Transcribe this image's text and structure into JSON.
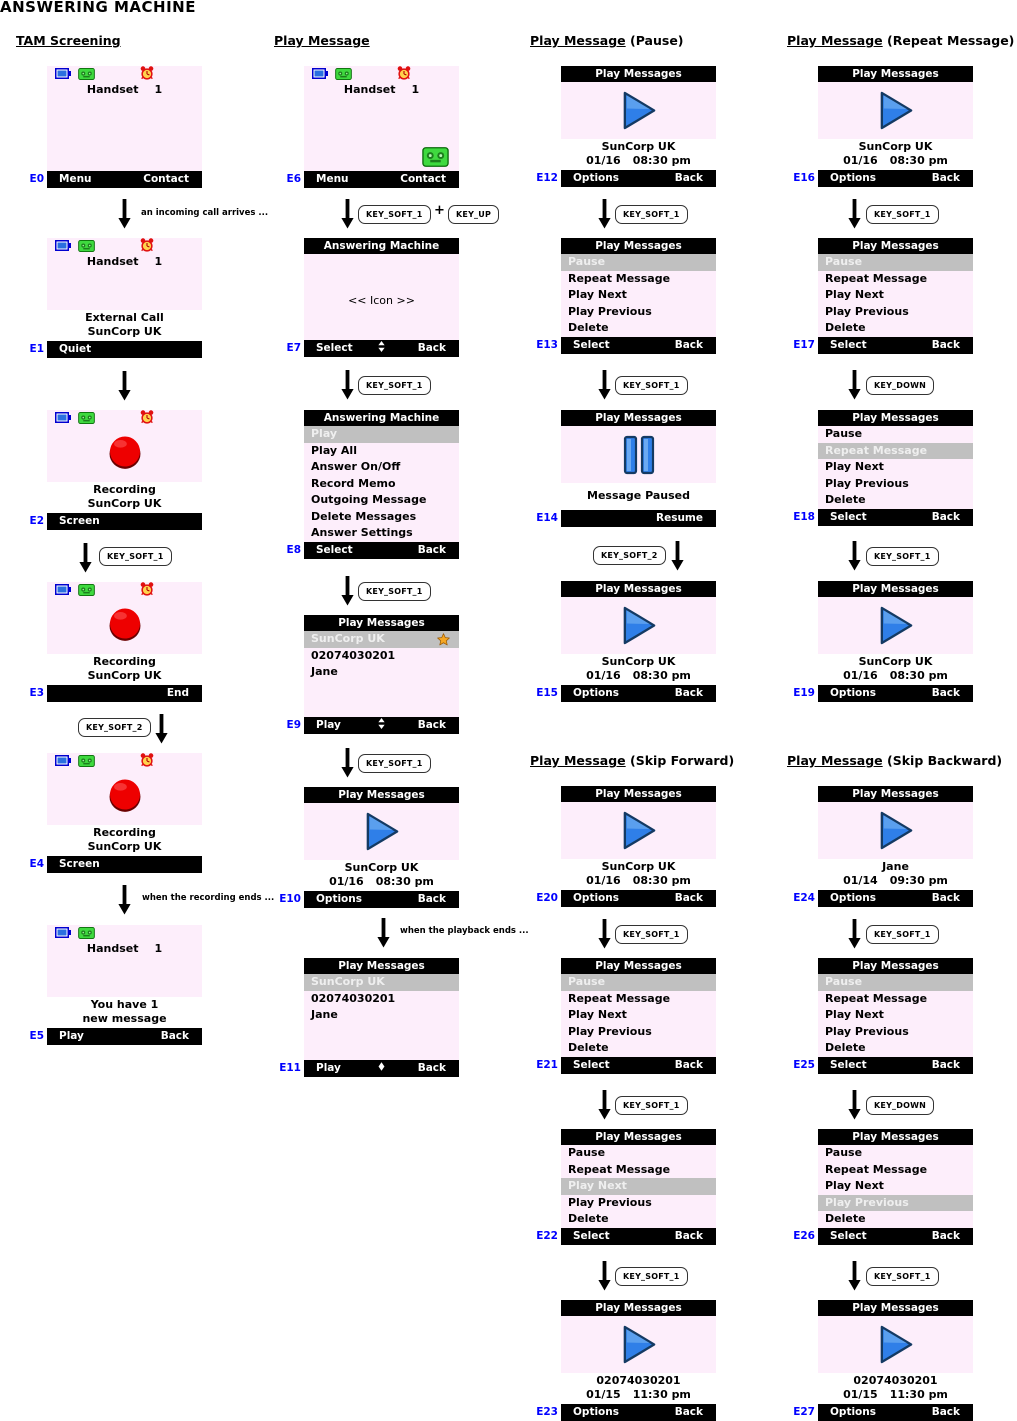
{
  "page": {
    "title": "ANSWERING MACHINE"
  },
  "sections": [
    {
      "id": "tam",
      "title": "TAM Screening",
      "suffix": ""
    },
    {
      "id": "play",
      "title": "Play Message",
      "suffix": ""
    },
    {
      "id": "pause",
      "title": "Play Message",
      "suffix": " (Pause)"
    },
    {
      "id": "rep",
      "title": "Play Message",
      "suffix": " (Repeat Message)"
    },
    {
      "id": "fwd",
      "title": "Play Message",
      "suffix": " (Skip Forward)"
    },
    {
      "id": "bwd",
      "title": "Play Message",
      "suffix": " (Skip Backward)"
    }
  ],
  "labels": {
    "menu": "Menu",
    "contact": "Contact",
    "quiet": "Quiet",
    "screen": "Screen",
    "end": "End",
    "play": "Play",
    "back": "Back",
    "select": "Select",
    "options": "Options",
    "resume": "Resume",
    "handset": "Handset",
    "handset_num": "1",
    "external_call": "External Call",
    "recording": "Recording",
    "message_paused": "Message Paused",
    "you_have_1": "You have 1",
    "new_message": "new message",
    "icon_placeholder": "<< Icon >>"
  },
  "titles": {
    "answering_machine": "Answering Machine",
    "play_messages": "Play Messages"
  },
  "contacts": {
    "suncorp": "SunCorp UK",
    "number": "02074030201",
    "jane": "Jane"
  },
  "stamps": {
    "suncorp_date": "01/16",
    "suncorp_time": "08:30 pm",
    "number_date": "01/15",
    "number_time": "11:30 pm",
    "jane_date": "01/14",
    "jane_time": "09:30 pm"
  },
  "am_menu": [
    "Play",
    "Play All",
    "Answer On/Off",
    "Record Memo",
    "Outgoing Message",
    "Delete Messages",
    "Answer Settings"
  ],
  "pm_options": [
    "Pause",
    "Repeat Message",
    "Play Next",
    "Play Previous",
    "Delete"
  ],
  "keys": {
    "soft1": "KEY_SOFT_1",
    "soft2": "KEY_SOFT_2",
    "up": "KEY_UP",
    "down": "KEY_DOWN",
    "plus": "+"
  },
  "notes": {
    "incoming": "an incoming call arrives ...",
    "rec_ends": "when the recording ends ...",
    "play_ends": "when the playback ends ..."
  },
  "screen_ids": {
    "e0": "E0",
    "e1": "E1",
    "e2": "E2",
    "e3": "E3",
    "e4": "E4",
    "e5": "E5",
    "e6": "E6",
    "e7": "E7",
    "e8": "E8",
    "e9": "E9",
    "e10": "E10",
    "e11": "E11",
    "e12": "E12",
    "e13": "E13",
    "e14": "E14",
    "e15": "E15",
    "e16": "E16",
    "e17": "E17",
    "e18": "E18",
    "e19": "E19",
    "e20": "E20",
    "e21": "E21",
    "e22": "E22",
    "e23": "E23",
    "e24": "E24",
    "e25": "E25",
    "e26": "E26",
    "e27": "E27"
  },
  "colors": {
    "screen_bg": "#fdeefb",
    "bar_bg": "#000000",
    "bar_fg": "#ffffff",
    "select_bg": "#c0c0c0",
    "select_fg": "#efefef",
    "id_color": "#0000ff",
    "play_blue": "#2f7fe8",
    "rec_red": "#ee0000",
    "star_gold": "#f5a623",
    "tape_green": "#3cdc3c"
  }
}
